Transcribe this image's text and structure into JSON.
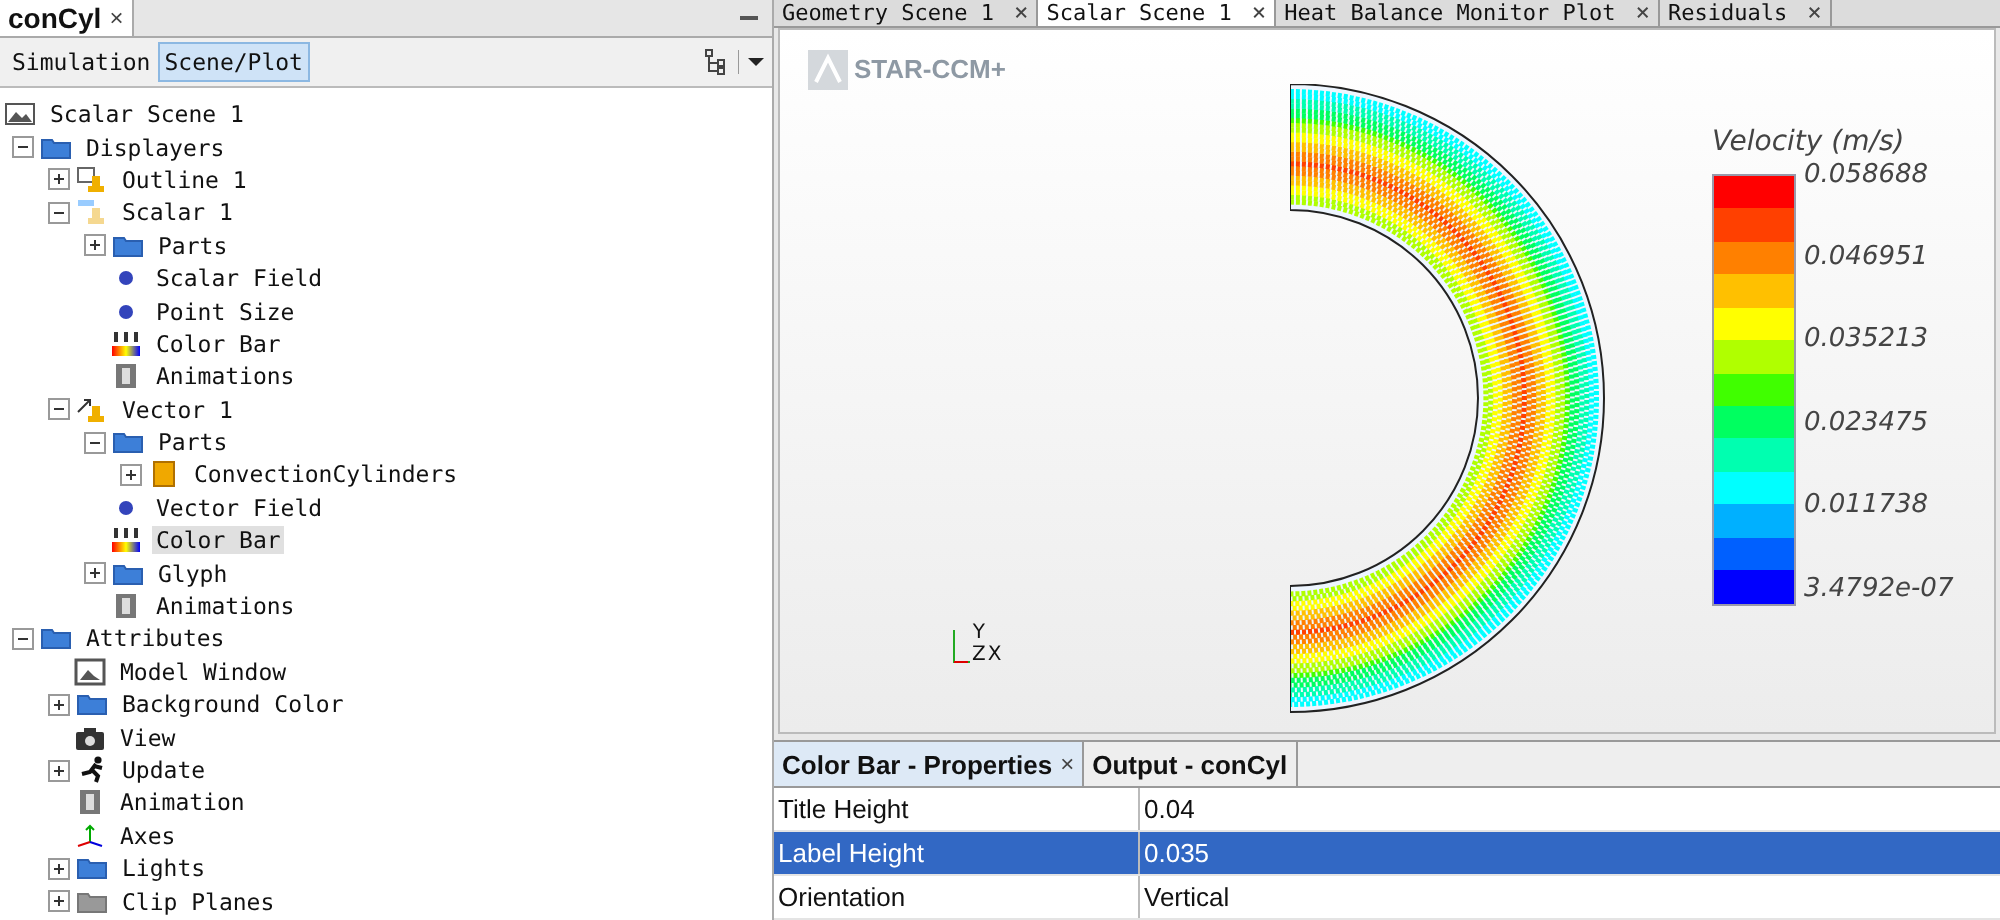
{
  "left_panel": {
    "tab": {
      "label": "conCyl",
      "close": "×"
    },
    "views": [
      {
        "label": "Simulation",
        "selected": false
      },
      {
        "label": "Scene/Plot",
        "selected": true
      }
    ],
    "tree": [
      {
        "label": "Scalar Scene 1",
        "kind": "scene",
        "selected": false,
        "children": [
          {
            "label": "Displayers",
            "kind": "folder",
            "expanded": true,
            "selected": false,
            "children": [
              {
                "label": "Outline 1",
                "kind": "outline",
                "expanded": false,
                "selected": false
              },
              {
                "label": "Scalar 1",
                "kind": "scalar",
                "expanded": true,
                "selected": false,
                "children": [
                  {
                    "label": "Parts",
                    "kind": "folder",
                    "expanded": false,
                    "selected": false
                  },
                  {
                    "label": "Scalar Field",
                    "kind": "dot",
                    "selected": false
                  },
                  {
                    "label": "Point Size",
                    "kind": "dot",
                    "selected": false
                  },
                  {
                    "label": "Color Bar",
                    "kind": "colorbar",
                    "selected": false
                  },
                  {
                    "label": "Animations",
                    "kind": "film",
                    "selected": false
                  }
                ]
              },
              {
                "label": "Vector 1",
                "kind": "vector",
                "expanded": true,
                "selected": false,
                "children": [
                  {
                    "label": "Parts",
                    "kind": "folder",
                    "expanded": true,
                    "selected": false,
                    "children": [
                      {
                        "label": "ConvectionCylinders",
                        "kind": "part",
                        "expanded": false,
                        "selected": false
                      }
                    ]
                  },
                  {
                    "label": "Vector Field",
                    "kind": "dot",
                    "selected": false
                  },
                  {
                    "label": "Color Bar",
                    "kind": "colorbar",
                    "selected": true
                  },
                  {
                    "label": "Glyph",
                    "kind": "folder",
                    "expanded": false,
                    "selected": false
                  },
                  {
                    "label": "Animations",
                    "kind": "film",
                    "selected": false
                  }
                ]
              }
            ]
          },
          {
            "label": "Attributes",
            "kind": "folder",
            "expanded": true,
            "selected": false,
            "children": [
              {
                "label": "Model Window",
                "kind": "window",
                "selected": false
              },
              {
                "label": "Background Color",
                "kind": "folder",
                "expanded": false,
                "selected": false
              },
              {
                "label": "View",
                "kind": "camera",
                "selected": false
              },
              {
                "label": "Update",
                "kind": "run",
                "expanded": false,
                "selected": false
              },
              {
                "label": "Animation",
                "kind": "film",
                "selected": false
              },
              {
                "label": "Axes",
                "kind": "axes",
                "selected": false
              },
              {
                "label": "Lights",
                "kind": "folder",
                "expanded": false,
                "selected": false
              },
              {
                "label": "Clip Planes",
                "kind": "greyfolder",
                "expanded": false,
                "selected": false
              }
            ]
          }
        ]
      }
    ]
  },
  "scene_tabs": [
    {
      "label": "Geometry Scene 1",
      "selected": false,
      "close": "×"
    },
    {
      "label": "Scalar Scene 1",
      "selected": true,
      "close": "×"
    },
    {
      "label": "Heat Balance Monitor Plot",
      "selected": false,
      "close": "×"
    },
    {
      "label": "Residuals",
      "selected": false,
      "close": "×"
    }
  ],
  "scene": {
    "logo": "STAR-CCM+",
    "legend": {
      "title": "Velocity (m/s)",
      "labels": [
        "0.058688",
        "0.046951",
        "0.035213",
        "0.023475",
        "0.011738",
        "3.4792e-07"
      ]
    },
    "triad": {
      "y": "Y",
      "z": "Z",
      "x": "X"
    }
  },
  "bottom_panel": {
    "tabs": [
      {
        "label": "Color Bar - Properties",
        "selected": true,
        "close": "×"
      },
      {
        "label": "Output - conCyl",
        "selected": false
      }
    ],
    "properties": [
      {
        "name": "Title Height",
        "value": "0.04",
        "selected": false
      },
      {
        "name": "Label Height",
        "value": "0.035",
        "selected": true
      },
      {
        "name": "Orientation",
        "value": "Vertical",
        "selected": false
      }
    ]
  }
}
